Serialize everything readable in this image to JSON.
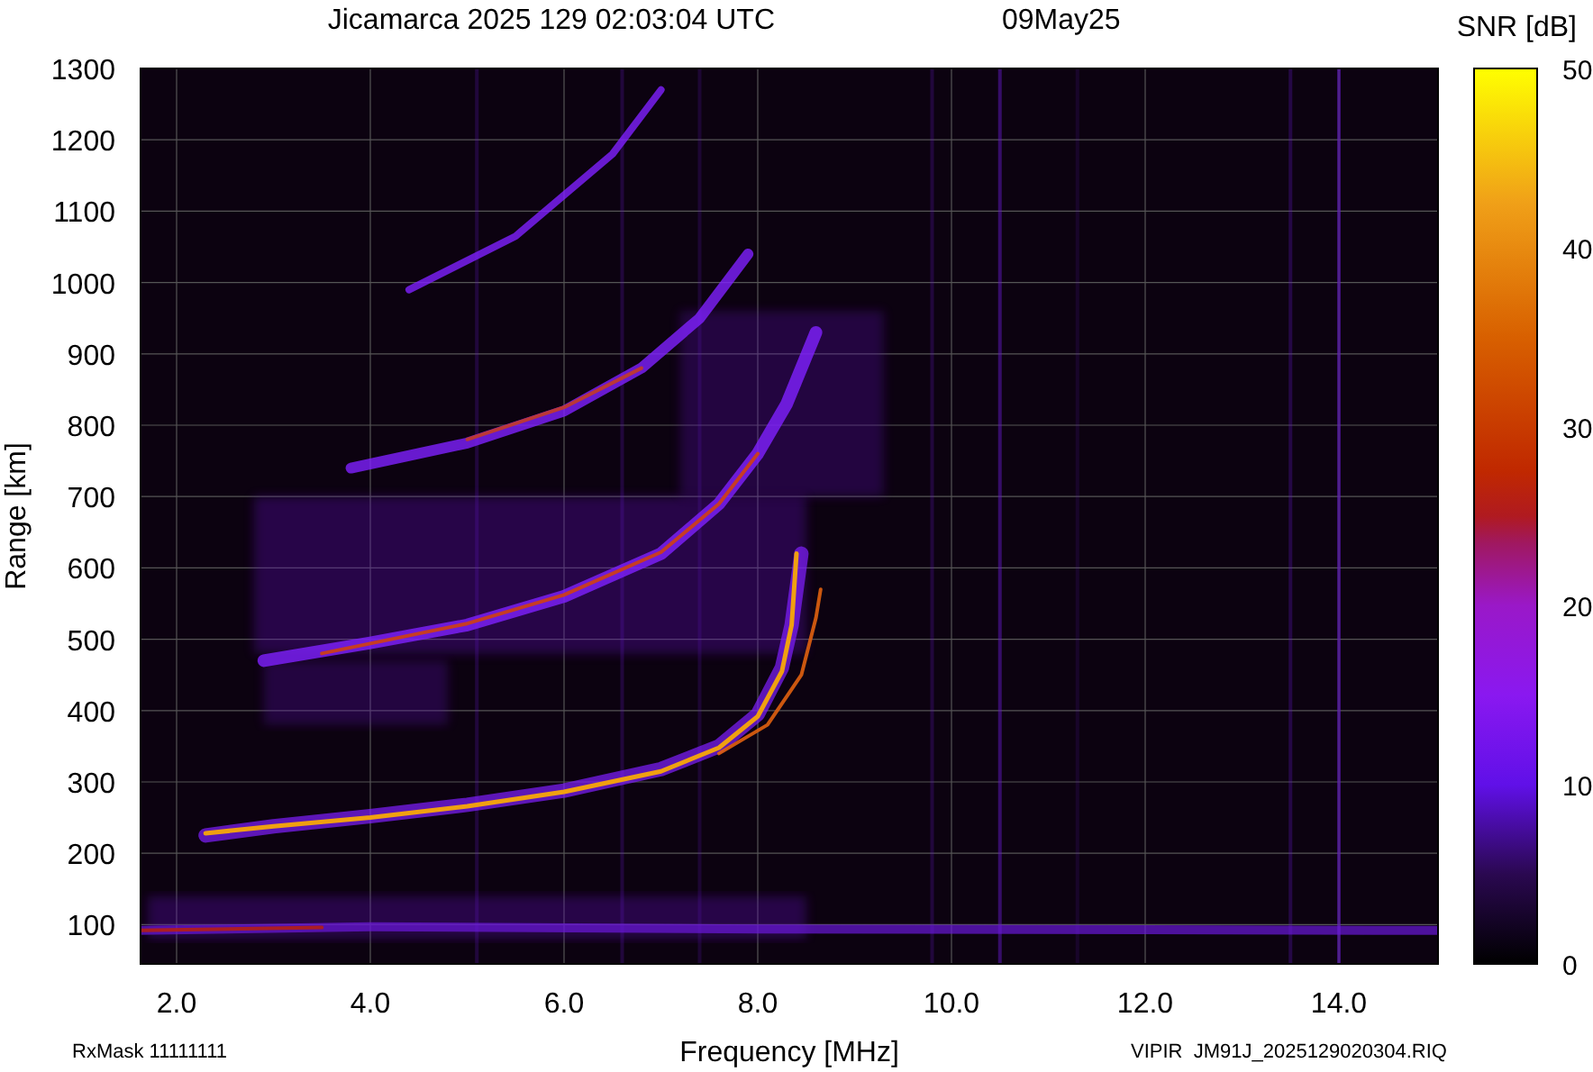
{
  "title": "Jicamarca 2025 129 02:03:04 UTC",
  "date": "09May25",
  "plot": {
    "ylabel": "Range [km]",
    "xlabel": "Frequency [MHz]",
    "yticks": [
      "1300",
      "1200",
      "1100",
      "1000",
      "900",
      "800",
      "700",
      "600",
      "500",
      "400",
      "300",
      "200",
      "100"
    ],
    "xticks": [
      "2.0",
      "4.0",
      "6.0",
      "8.0",
      "10.0",
      "12.0",
      "14.0"
    ]
  },
  "colorbar": {
    "title": "SNR [dB]",
    "ticks": [
      "50",
      "40",
      "30",
      "20",
      "10",
      "0"
    ]
  },
  "footer": {
    "rx_mask": "RxMask 11111111",
    "file": "VIPIR  JM91J_2025129020304.RIQ"
  }
}
